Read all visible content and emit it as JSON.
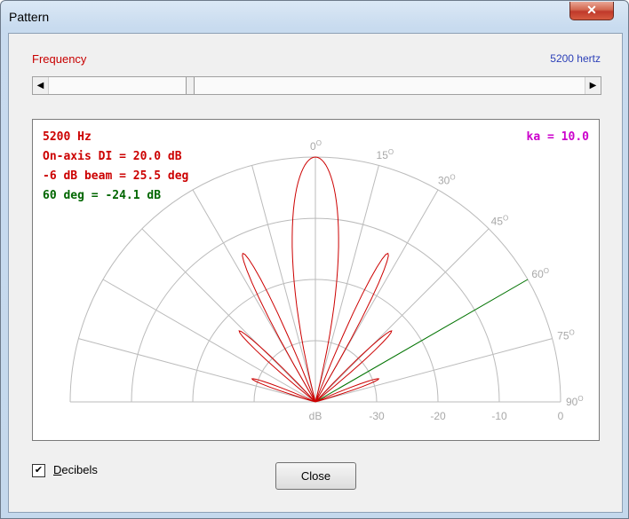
{
  "window": {
    "title": "Pattern",
    "close_glyph": "✕"
  },
  "frequency": {
    "label": "Frequency",
    "value": "5200 hertz",
    "slider_level": 0.26
  },
  "scrollbar": {
    "left_arrow": "◀",
    "right_arrow": "▶"
  },
  "plot": {
    "info": {
      "freq": "5200 Hz",
      "di": "On-axis DI = 20.0 dB",
      "beam": "-6 dB beam = 25.5 deg",
      "angle60": "60 deg = -24.1 dB",
      "ka": "ka = 10.0"
    },
    "angle_labels": [
      "0",
      "15",
      "30",
      "45",
      "60",
      "75",
      "90"
    ],
    "angle_unit_glyph": "O",
    "db_labels": [
      "dB",
      "-30",
      "-20",
      "-10",
      "0"
    ],
    "colors": {
      "pattern": "#cc0000",
      "angle60_line": "#007700",
      "grid": "#bbbbbb",
      "info_red": "#cc0000",
      "info_green": "#006600",
      "ka": "#cc00cc"
    }
  },
  "chart_data": {
    "type": "polar",
    "ka": 10.0,
    "frequency_hz": 5200,
    "radial_range_db": [
      -40,
      0
    ],
    "radial_ticks_db": [
      -30,
      -20,
      -10,
      0
    ],
    "angle_range_deg": [
      0,
      90
    ],
    "angle_ticks_deg": [
      0,
      15,
      30,
      45,
      60,
      75,
      90
    ],
    "marker_angle_deg": 60,
    "marker_level_db": -24.1
  },
  "decibels": {
    "label_first": "D",
    "label_rest": "ecibels",
    "checked": "✔"
  },
  "close_button": {
    "label": "Close"
  }
}
